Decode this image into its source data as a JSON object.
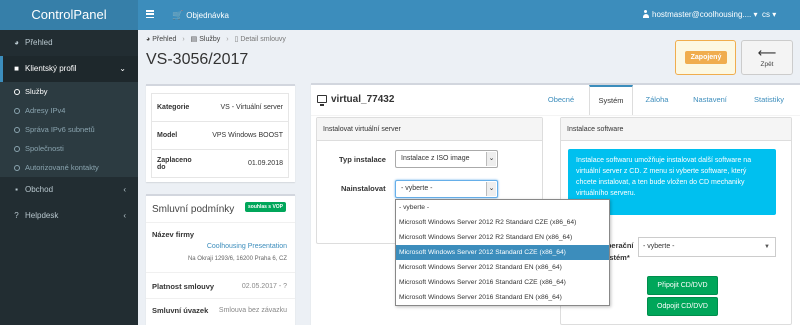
{
  "app": {
    "brand": "ControlPanel"
  },
  "header": {
    "order_label": "Objednávka",
    "user_email": "hostmaster@coolhousing....",
    "lang": "cs"
  },
  "sidebar": {
    "items": [
      {
        "label": "Přehled",
        "icon": "dashboard-icon"
      },
      {
        "label": "Klientský profil",
        "icon": "user-icon"
      },
      {
        "label": "Obchod",
        "icon": "briefcase-icon"
      },
      {
        "label": "Helpdesk",
        "icon": "question-icon"
      }
    ],
    "subitems": [
      {
        "label": "Služby"
      },
      {
        "label": "Adresy IPv4"
      },
      {
        "label": "Správa IPv6 subnetů"
      },
      {
        "label": "Společnosti"
      },
      {
        "label": "Autorizované kontakty"
      }
    ]
  },
  "breadcrumb": {
    "home": "Přehled",
    "services": "Služby",
    "current": "Detail smlouvy"
  },
  "page": {
    "title": "VS-3056/2017",
    "status": "Zapojený",
    "back_label": "Zpět"
  },
  "info": {
    "rows": [
      {
        "k": "Kategorie",
        "v": "VS - Virtuální server"
      },
      {
        "k": "Model",
        "v": "VPS Windows BOOST"
      },
      {
        "k": "Zaplaceno do",
        "v": "01.09.2018"
      }
    ]
  },
  "contract": {
    "title": "Smluvní podmínky",
    "badge": "souhlas s VOP",
    "company_label": "Název firmy",
    "company_name": "Coolhousing Presentation",
    "company_address": "Na Okraji 1293/6, 16200 Praha 6, CZ",
    "validity_label": "Platnost smlouvy",
    "validity_value": "02.05.2017 - ?",
    "term_label": "Smluvní úvazek",
    "term_value": "Smlouva bez závazku"
  },
  "main": {
    "vm_name": "virtual_77432",
    "tabs": [
      "Obecné",
      "Systém",
      "Záloha",
      "Nastavení",
      "Statistiky"
    ],
    "active_tab": "Systém",
    "install_panel": {
      "title": "Instalovat virtuální server",
      "type_label": "Typ instalace",
      "type_value": "Instalace z ISO image",
      "install_label": "Nainstalovat",
      "install_value": "- vyberte -"
    },
    "dropdown": {
      "options": [
        "- vyberte -",
        "Microsoft Windows Server 2012 R2 Standard CZE (x86_64)",
        "Microsoft Windows Server 2012 R2 Standard EN (x86_64)",
        "Microsoft Windows Server 2012 Standard CZE (x86_64)",
        "Microsoft Windows Server 2012 Standard EN (x86_64)",
        "Microsoft Windows Server 2016 Standard CZE (x86_64)",
        "Microsoft Windows Server 2016 Standard EN (x86_64)"
      ],
      "highlighted_index": 3
    },
    "software_panel": {
      "title": "Instalace software",
      "callout": "Instalace softwaru umožňuje instalovat další software na virtuální server z CD. Z menu si vyberte software, který chcete instalovat, a ten bude vložen do CD mechaniky virtuálního serveru.",
      "os_label_line1": "Operační",
      "os_label_line2": "systém*",
      "os_value": "- vyberte -",
      "connect_button": "Připojit CD/DVD",
      "disconnect_button": "Odpojit CD/DVD"
    }
  },
  "colors": {
    "header": "#3c8dbc",
    "brand_bg": "#367fa9",
    "sidebar": "#222d32",
    "status_warning": "#f0ad4e",
    "success": "#00a65a",
    "info": "#00c0ef"
  }
}
